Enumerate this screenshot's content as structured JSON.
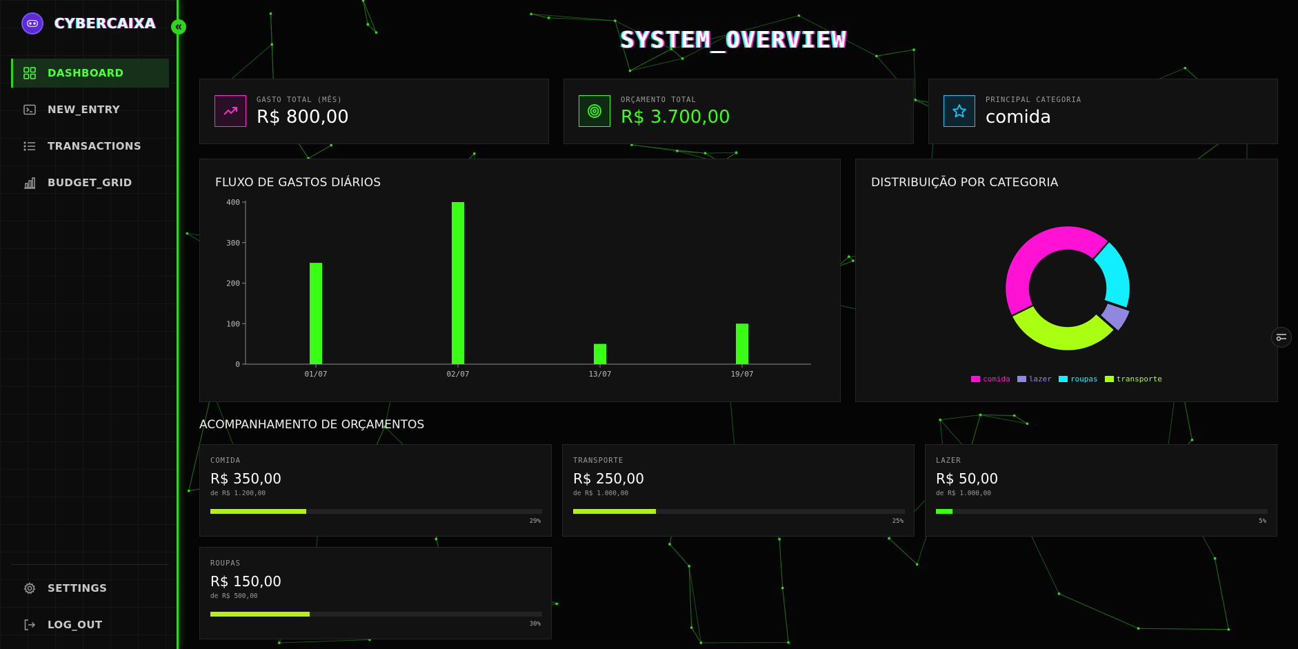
{
  "app": {
    "name": "CYBERCAIXA"
  },
  "sidebar": {
    "items": [
      {
        "label": "DASHBOARD",
        "icon": "grid-icon",
        "active": true
      },
      {
        "label": "NEW_ENTRY",
        "icon": "terminal-icon",
        "active": false
      },
      {
        "label": "TRANSACTIONS",
        "icon": "list-icon",
        "active": false
      },
      {
        "label": "BUDGET_GRID",
        "icon": "bar-chart-icon",
        "active": false
      }
    ],
    "bottom": [
      {
        "label": "SETTINGS",
        "icon": "gear-icon"
      },
      {
        "label": "LOG_OUT",
        "icon": "logout-icon"
      }
    ]
  },
  "page": {
    "title": "SYSTEM_OVERVIEW"
  },
  "stats": [
    {
      "label": "GASTO TOTAL (MÊS)",
      "value": "R$ 800,00",
      "icon": "trending-up-icon",
      "color": "#ff2bd6"
    },
    {
      "label": "ORÇAMENTO TOTAL",
      "value": "R$ 3.700,00",
      "icon": "target-icon",
      "color": "#39ff14"
    },
    {
      "label": "PRINCIPAL CATEGORIA",
      "value": "comida",
      "icon": "star-icon",
      "color": "#15c8ee"
    }
  ],
  "charts": {
    "daily_title": "FLUXO DE GASTOS DIÁRIOS",
    "category_title": "DISTRIBUIÇÃO POR CATEGORIA"
  },
  "chart_data": [
    {
      "type": "bar",
      "title": "FLUXO DE GASTOS DIÁRIOS",
      "categories": [
        "01/07",
        "02/07",
        "13/07",
        "19/07"
      ],
      "values": [
        250,
        400,
        50,
        100
      ],
      "yticks": [
        0,
        100,
        200,
        300,
        400
      ],
      "ylim": [
        0,
        400
      ],
      "color": "#39ff14",
      "grid": false
    },
    {
      "type": "pie",
      "title": "DISTRIBUIÇÃO POR CATEGORIA",
      "categories": [
        "comida",
        "lazer",
        "roupas",
        "transporte"
      ],
      "values": [
        350,
        50,
        150,
        250
      ],
      "order_drawn": [
        "roupas",
        "lazer",
        "transporte",
        "comida"
      ],
      "colors": [
        "#ff12d4",
        "#8f88e0",
        "#12f0ff",
        "#aaff12"
      ],
      "legend": "bottom",
      "donut": true
    }
  ],
  "budgets": {
    "title": "ACOMPANHAMENTO DE ORÇAMENTOS",
    "items": [
      {
        "category": "COMIDA",
        "spent": "R$ 350,00",
        "limit": "de R$ 1.200,00",
        "percent_label": "29%",
        "fraction": 0.29,
        "color": "#b4ef16"
      },
      {
        "category": "TRANSPORTE",
        "spent": "R$ 250,00",
        "limit": "de R$ 1.000,00",
        "percent_label": "25%",
        "fraction": 0.25,
        "color": "#b4ef16"
      },
      {
        "category": "LAZER",
        "spent": "R$ 50,00",
        "limit": "de R$ 1.000,00",
        "percent_label": "5%",
        "fraction": 0.05,
        "color": "#39ff14"
      },
      {
        "category": "ROUPAS",
        "spent": "R$ 150,00",
        "limit": "de R$ 500,00",
        "percent_label": "30%",
        "fraction": 0.3,
        "color": "#b4ef16"
      }
    ]
  }
}
